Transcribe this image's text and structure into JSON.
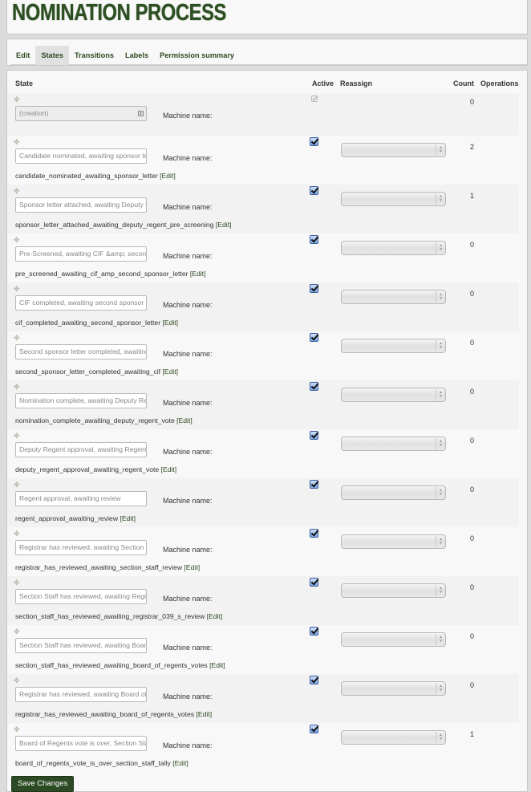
{
  "page": {
    "title": "NOMINATION PROCESS"
  },
  "tabs": [
    {
      "label": "Edit",
      "active": false
    },
    {
      "label": "States",
      "active": true
    },
    {
      "label": "Transitions",
      "active": false
    },
    {
      "label": "Labels",
      "active": false
    },
    {
      "label": "Permission summary",
      "active": false
    }
  ],
  "table": {
    "headers": {
      "state": "State",
      "active": "Active",
      "reassign": "Reassign",
      "count": "Count",
      "operations": "Operations"
    },
    "machine_name_label": "Machine name:",
    "edit_link": "[Edit]",
    "rows": [
      {
        "state": "(creation)",
        "machine_name": "",
        "active": true,
        "disabled": true,
        "count": "0"
      },
      {
        "state": "Candidate nominated, awaiting sponsor letter",
        "machine_name": "candidate_nominated_awaiting_sponsor_letter",
        "active": true,
        "count": "2"
      },
      {
        "state": "Sponsor letter attached, awaiting Deputy Regent pre-screening",
        "machine_name": "sponsor_letter_attached_awaiting_deputy_regent_pre_screening",
        "active": true,
        "count": "1"
      },
      {
        "state": "Pre-Screened, awaiting CIF &amp; second sponsor letter",
        "machine_name": "pre_screened_awaiting_cif_amp_second_sponsor_letter",
        "active": true,
        "count": "0"
      },
      {
        "state": "CIF completed, awaiting second sponsor letter",
        "machine_name": "cif_completed_awaiting_second_sponsor_letter",
        "active": true,
        "count": "0"
      },
      {
        "state": "Second sponsor letter completed, awaiting CIF",
        "machine_name": "second_sponsor_letter_completed_awaiting_cif",
        "active": true,
        "count": "0"
      },
      {
        "state": "Nomination complete, awaiting Deputy Regent vote",
        "machine_name": "nomination_complete_awaiting_deputy_regent_vote",
        "active": true,
        "count": "0"
      },
      {
        "state": "Deputy Regent approval, awaiting Regent vote",
        "machine_name": "deputy_regent_approval_awaiting_regent_vote",
        "active": true,
        "count": "0"
      },
      {
        "state": "Regent approval, awaiting review",
        "machine_name": "regent_approval_awaiting_review",
        "active": true,
        "count": "0"
      },
      {
        "state": "Registrar has reviewed, awaiting Section Staff review",
        "machine_name": "registrar_has_reviewed_awaiting_section_staff_review",
        "active": true,
        "count": "0"
      },
      {
        "state": "Section Staff has reviewed, awaiting Registrar's review",
        "machine_name": "section_staff_has_reviewed_awaiting_registrar_039_s_review",
        "active": true,
        "count": "0"
      },
      {
        "state": "Section Staff has reviewed, awaiting Board of Regents votes",
        "machine_name": "section_staff_has_reviewed_awaiting_board_of_regents_votes",
        "active": true,
        "count": "0"
      },
      {
        "state": "Registrar has reviewed, awaiting Board of Regents votes",
        "machine_name": "registrar_has_reviewed_awaiting_board_of_regents_votes",
        "active": true,
        "count": "0"
      },
      {
        "state": "Board of Regents vote is over, Section Staff tally",
        "machine_name": "board_of_regents_vote_is_over_section_staff_tally",
        "active": true,
        "count": "1"
      }
    ]
  },
  "actions": {
    "save_label": "Save Changes"
  },
  "colors": {
    "brand_green": "#2d4f22",
    "button_bg": "#2c4b24"
  }
}
